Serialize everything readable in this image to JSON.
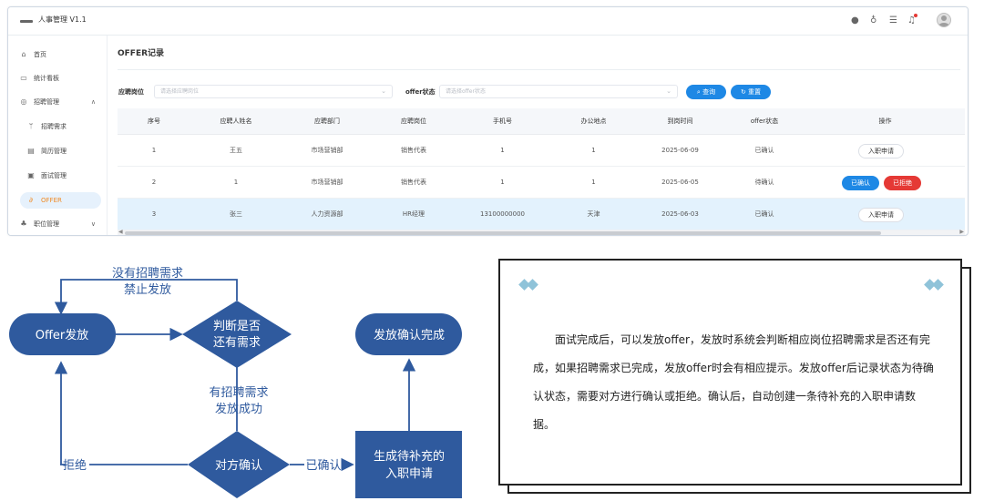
{
  "app": {
    "title": "人事管理 V1.1"
  },
  "sidebar": {
    "items": [
      {
        "label": "首页",
        "icon": "home-icon",
        "glyph": "⌂",
        "arrow": ""
      },
      {
        "label": "统计看板",
        "icon": "monitor-icon",
        "glyph": "▭",
        "arrow": ""
      },
      {
        "label": "招聘管理",
        "icon": "recruit-icon",
        "glyph": "◎",
        "arrow": "∧"
      },
      {
        "label": "招聘需求",
        "icon": "branch-icon",
        "glyph": "ᛘ",
        "arrow": ""
      },
      {
        "label": "简历管理",
        "icon": "resume-icon",
        "glyph": "▤",
        "arrow": ""
      },
      {
        "label": "面试管理",
        "icon": "interview-icon",
        "glyph": "▣",
        "arrow": ""
      },
      {
        "label": "OFFER",
        "icon": "link-icon",
        "glyph": "∂",
        "arrow": ""
      },
      {
        "label": "职位管理",
        "icon": "org-icon",
        "glyph": "♣",
        "arrow": "∨"
      }
    ]
  },
  "page": {
    "title": "OFFER记录"
  },
  "filters": {
    "position_label": "应聘岗位",
    "position_placeholder": "请选择应聘岗位",
    "status_label": "offer状态",
    "status_placeholder": "请选择offer状态",
    "query_label": "查询",
    "reset_label": "重置"
  },
  "table": {
    "headers": [
      "序号",
      "应聘人姓名",
      "应聘部门",
      "应聘岗位",
      "手机号",
      "办公地点",
      "到岗时间",
      "offer状态",
      "操作"
    ],
    "rows": [
      {
        "cells": [
          "1",
          "王五",
          "市场营销部",
          "销售代表",
          "1",
          "1",
          "2025-06-09",
          "已确认"
        ],
        "action": "入职申请"
      },
      {
        "cells": [
          "2",
          "1",
          "市场营销部",
          "销售代表",
          "1",
          "1",
          "2025-06-05",
          "待确认"
        ],
        "confirm": "已确认",
        "reject": "已拒绝"
      },
      {
        "cells": [
          "3",
          "张三",
          "人力资源部",
          "HR经理",
          "13100000000",
          "天津",
          "2025-06-03",
          "已确认"
        ],
        "action": "入职申请"
      }
    ]
  },
  "flow": {
    "start": "Offer发放",
    "decision1_line1": "判断是否",
    "decision1_line2": "还有需求",
    "no_demand_line1": "没有招聘需求",
    "no_demand_line2": "禁止发放",
    "has_demand_line1": "有招聘需求",
    "has_demand_line2": "发放成功",
    "decision2": "对方确认",
    "reject": "拒绝",
    "confirmed": "已确认",
    "process_line1": "生成待补充的",
    "process_line2": "入职申请",
    "end": "发放确认完成"
  },
  "note": {
    "text": "面试完成后，可以发放offer，发放时系统会判断相应岗位招聘需求是否还有完成，如果招聘需求已完成，发放offer时会有相应提示。发放offer后记录状态为待确认状态，需要对方进行确认或拒绝。确认后，自动创建一条待补充的入职申请数据。"
  },
  "colors": {
    "flow_blue": "#2f5a9e",
    "accent_blue": "#1e88e5",
    "reject_red": "#e53935",
    "active_orange": "#f08a24"
  }
}
